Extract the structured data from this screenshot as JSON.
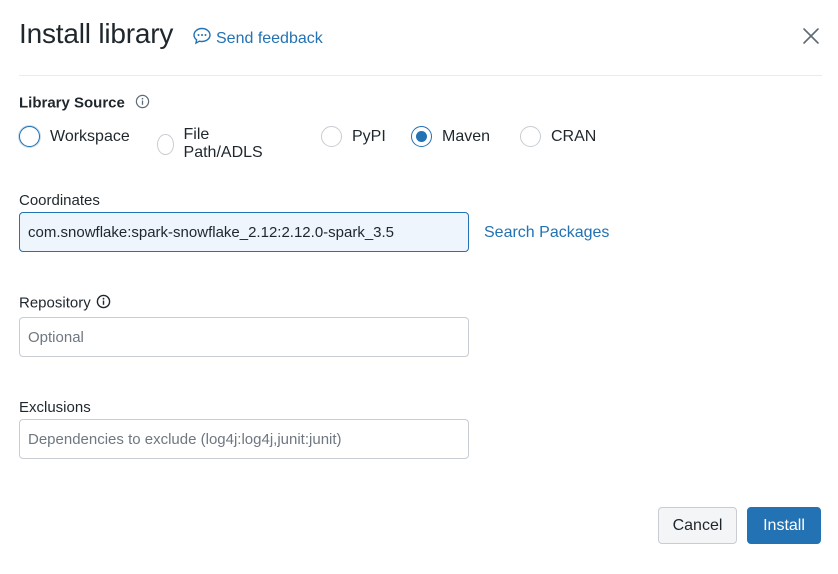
{
  "dialog": {
    "title": "Install library",
    "feedback_label": "Send feedback",
    "close_icon": "close-icon"
  },
  "library_source": {
    "label": "Library Source",
    "options": [
      "Workspace",
      "File Path/ADLS",
      "PyPI",
      "Maven",
      "CRAN"
    ],
    "selected": "Maven"
  },
  "coordinates": {
    "label": "Coordinates",
    "value": "com.snowflake:spark-snowflake_2.12:2.12.0-spark_3.5",
    "search_label": "Search Packages"
  },
  "repository": {
    "label": "Repository",
    "placeholder": "Optional"
  },
  "exclusions": {
    "label": "Exclusions",
    "placeholder": "Dependencies to exclude (log4j:log4j,junit:junit)"
  },
  "buttons": {
    "cancel": "Cancel",
    "install": "Install"
  },
  "colors": {
    "accent": "#2272b4",
    "text": "#1f272d",
    "border": "#c7cdd3"
  }
}
